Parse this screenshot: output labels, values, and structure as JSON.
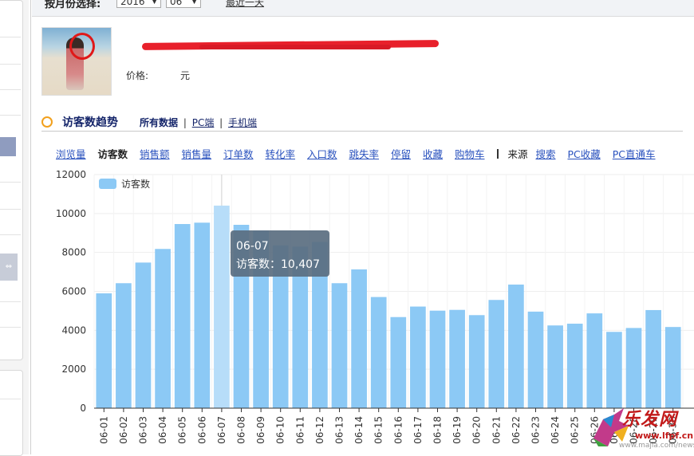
{
  "filter": {
    "label": "按月份选择:",
    "year": "2016",
    "month": "06",
    "recent_link": "最近一天"
  },
  "product": {
    "price_label": "价格:",
    "price_unit": "元"
  },
  "section": {
    "title": "访客数趋势",
    "links": [
      "所有数据",
      "PC端",
      "手机端"
    ],
    "separator": "|"
  },
  "metrics": {
    "items": [
      "浏览量",
      "访客数",
      "销售额",
      "销售量",
      "订单数",
      "转化率",
      "入口数",
      "跳失率",
      "停留",
      "收藏",
      "购物车"
    ],
    "active_index": 1,
    "source_label": "来源",
    "source_items": [
      "搜索",
      "PC收藏",
      "PC直通车"
    ]
  },
  "tooltip": {
    "date": "06-07",
    "text": "访客数：10,407"
  },
  "watermark": {
    "brand": "乐发网",
    "url": "www.lfpf.cn",
    "url2": "www.majia.com/news"
  },
  "colors": {
    "bar": "#8cc9f5",
    "bar_highlight": "#b7ddf9",
    "tooltip_bg": "#5a6e80",
    "accent": "#f2a01d",
    "link": "#2a52be",
    "nav": "#15256a"
  },
  "chart_data": {
    "type": "bar",
    "legend": "访客数",
    "legend_position": "top-left",
    "categories": [
      "06-01",
      "06-02",
      "06-03",
      "06-04",
      "06-05",
      "06-06",
      "06-07",
      "06-08",
      "06-09",
      "06-10",
      "06-11",
      "06-12",
      "06-13",
      "06-14",
      "06-15",
      "06-16",
      "06-17",
      "06-18",
      "06-19",
      "06-20",
      "06-21",
      "06-22",
      "06-23",
      "06-24",
      "06-25",
      "06-26",
      "06-27",
      "06-28",
      "06-29",
      "06-30"
    ],
    "values": [
      5900,
      6420,
      7480,
      8180,
      9460,
      9530,
      10407,
      9420,
      9120,
      8360,
      8300,
      8540,
      6420,
      7130,
      5710,
      4680,
      5220,
      5010,
      5050,
      4780,
      5560,
      6350,
      4960,
      4250,
      4340,
      4870,
      3920,
      4120,
      5040,
      4170
    ],
    "highlight_index": 6,
    "ylim": [
      0,
      12000
    ],
    "yticks": [
      0,
      2000,
      4000,
      6000,
      8000,
      10000,
      12000
    ],
    "grid": true
  }
}
